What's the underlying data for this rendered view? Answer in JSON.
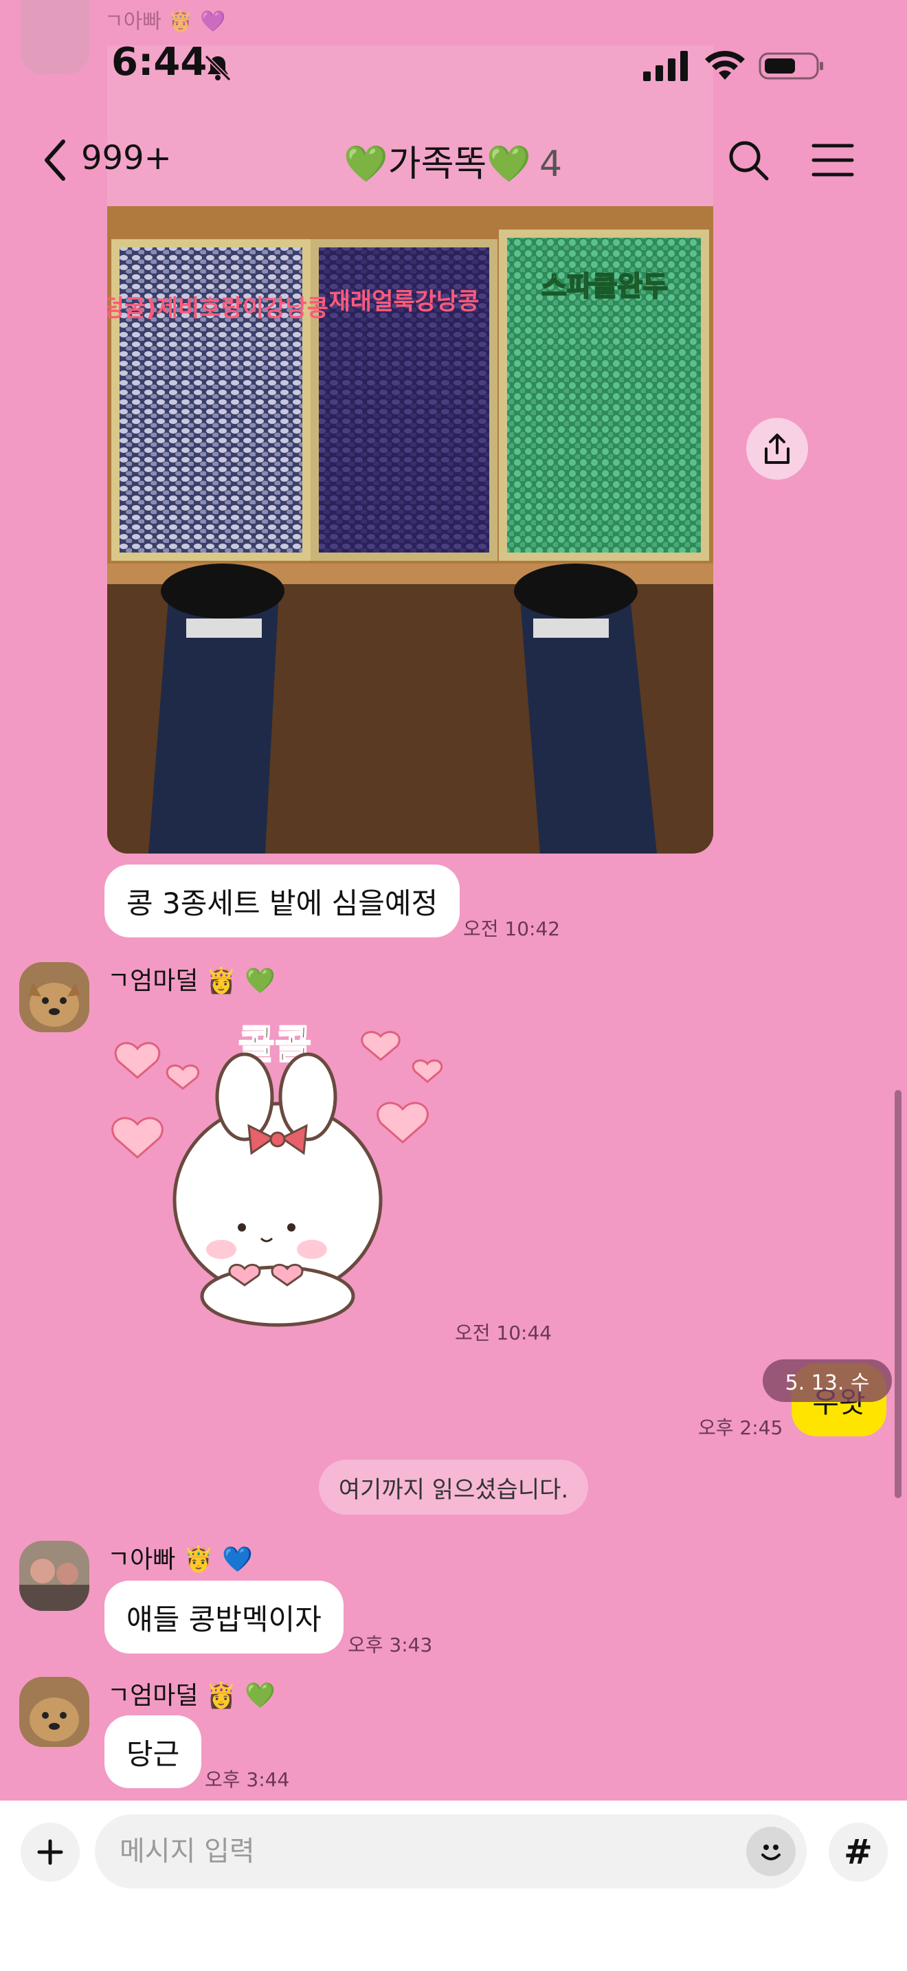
{
  "ghost_row": {
    "sender": "ㄱ아빠 🤴 💜"
  },
  "status_bar": {
    "time": "6:44"
  },
  "header": {
    "back_count": "999+",
    "title": "💚가족똑💚",
    "member_count": "4"
  },
  "messages": {
    "m1": {
      "text": "콩 3종세트 밭에 심을예정",
      "time": "오전 10:42"
    },
    "m2": {
      "sender": "ㄱ엄마덜 👸 💚",
      "sticker_text": "콜콜",
      "time": "오전 10:44"
    },
    "m3": {
      "text": "우왓",
      "time": "오후 2:45",
      "date_overlay": "5. 13. 수"
    },
    "read_marker": "여기까지 읽으셨습니다.",
    "m4": {
      "sender": "ㄱ아빠 🤴 💙",
      "text": "얘들 콩밥멕이자",
      "time": "오후 3:43"
    },
    "m5": {
      "sender": "ㄱ엄마덜 👸 💚",
      "text": "당근",
      "time": "오후 3:44"
    }
  },
  "photo": {
    "bags": [
      {
        "label": "(덩굴)제비호랑이강낭콩"
      },
      {
        "label": "재래얼룩강낭콩"
      },
      {
        "label": "스파클완두"
      }
    ]
  },
  "input": {
    "placeholder": "메시지 입력",
    "hash_label": "#"
  },
  "icons": {
    "back": "chevron-left-icon",
    "search": "search-icon",
    "menu": "hamburger-menu-icon",
    "share": "share-icon",
    "plus": "plus-icon",
    "emoji": "emoji-icon",
    "bell": "bell-slash-icon",
    "signal": "signal-icon",
    "wifi": "wifi-icon",
    "battery": "battery-icon"
  },
  "colors": {
    "background": "#F29AC3",
    "my_bubble": "#FEE500",
    "other_bubble": "#FFFFFF"
  }
}
